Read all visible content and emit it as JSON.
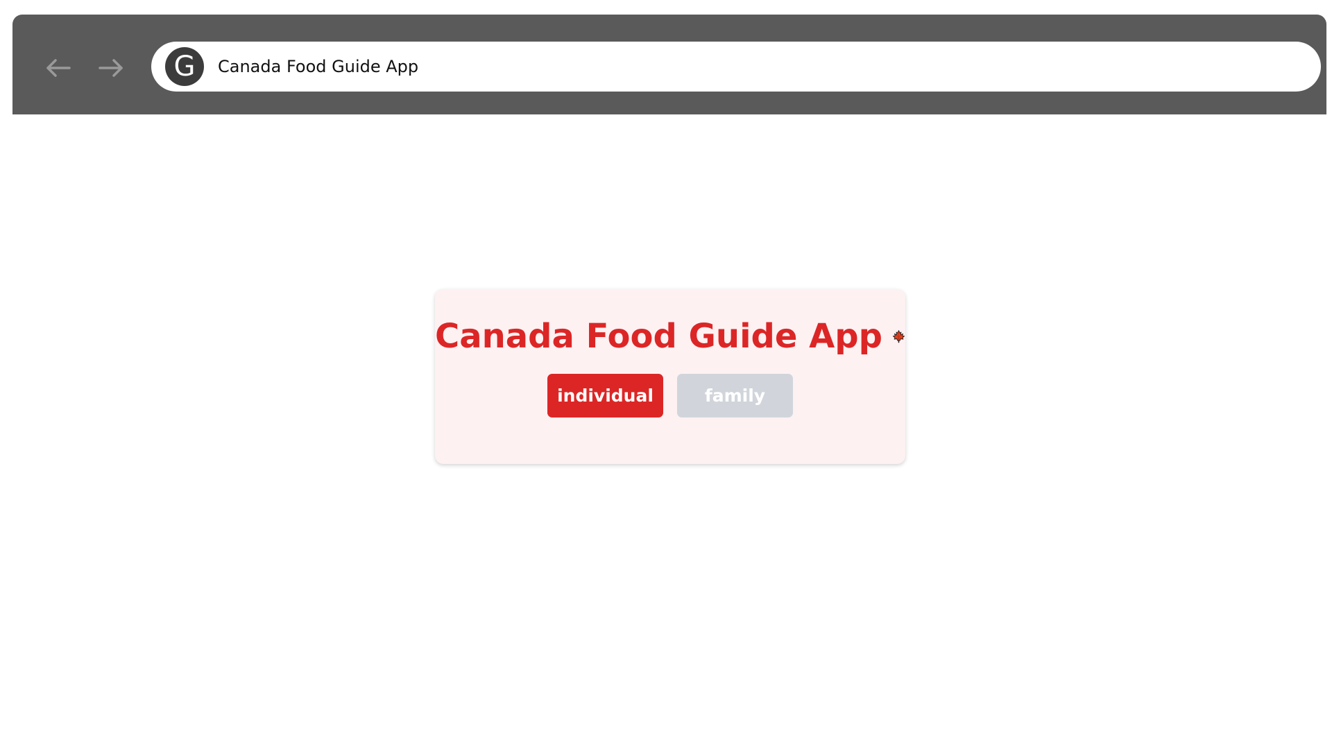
{
  "browser": {
    "site_icon_letter": "G",
    "address_text": "Canada Food Guide App",
    "back_icon": "arrow-left-icon",
    "forward_icon": "arrow-right-icon"
  },
  "app": {
    "title": "Canada Food Guide App",
    "title_icon": "maple-leaf-icon",
    "buttons": [
      {
        "label": "individual",
        "state": "selected"
      },
      {
        "label": "family",
        "state": "unselected"
      }
    ]
  },
  "colors": {
    "chrome": "#5a5a5a",
    "accent_red": "#dc2626",
    "card_bg": "#fdf1f2",
    "inactive_button": "#d1d5db"
  }
}
